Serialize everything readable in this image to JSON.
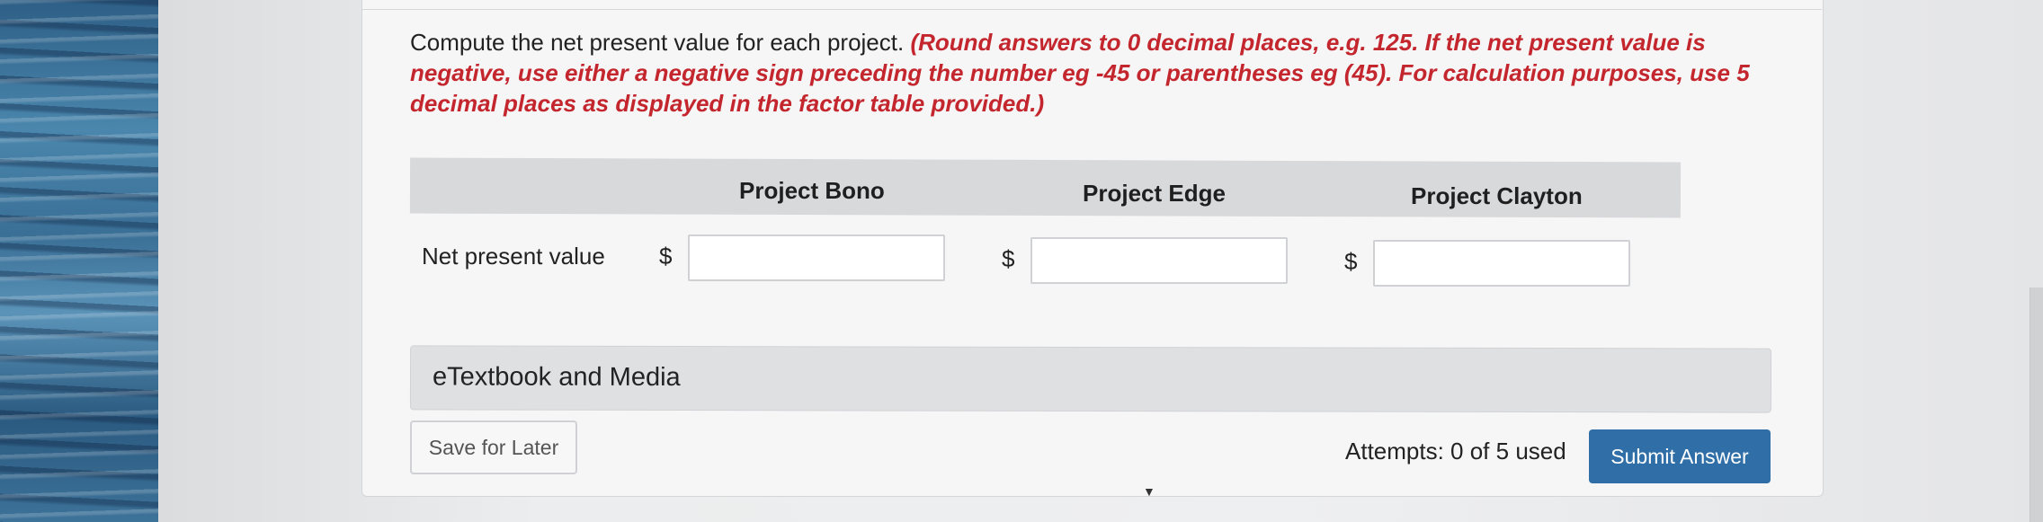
{
  "question": {
    "text": "Compute the net present value for each project.",
    "instruction": "(Round answers to 0 decimal places, e.g. 125. If the net present value is negative, use either a negative sign preceding the number eg -45 or parentheses eg (45). For calculation purposes, use 5 decimal places as displayed in the factor table provided.)"
  },
  "table": {
    "columns": [
      "Project Bono",
      "Project Edge",
      "Project Clayton"
    ],
    "row_label": "Net present value",
    "currency_symbol": "$",
    "values": [
      "",
      "",
      ""
    ]
  },
  "etextbook": {
    "label": "eTextbook and Media"
  },
  "footer": {
    "save_label": "Save for Later",
    "attempts": "Attempts: 0 of 5 used",
    "submit_label": "Submit Answer"
  },
  "colors": {
    "instruction_red": "#c4262e",
    "submit_blue": "#2f6ea6"
  },
  "icons": {
    "dropdown": "caret-down-icon"
  }
}
